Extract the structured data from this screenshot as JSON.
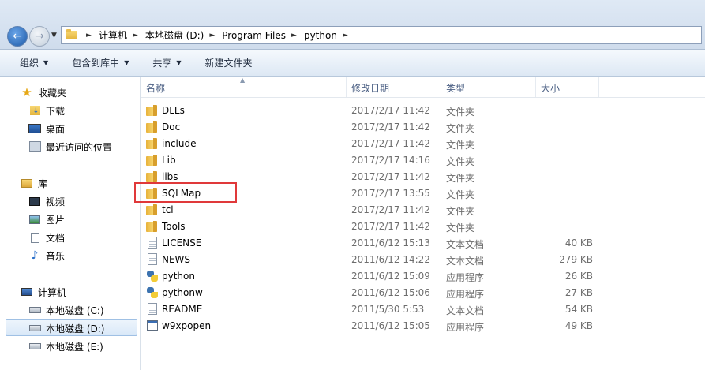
{
  "address": {
    "crumbs": [
      "计算机",
      "本地磁盘 (D:)",
      "Program Files",
      "python"
    ]
  },
  "toolbar": {
    "organize": "组织",
    "include_library": "包含到库中",
    "share": "共享",
    "new_folder": "新建文件夹"
  },
  "nav": {
    "favorites": "收藏夹",
    "downloads": "下载",
    "desktop": "桌面",
    "recent": "最近访问的位置",
    "libraries": "库",
    "videos": "视频",
    "pictures": "图片",
    "documents": "文档",
    "music": "音乐",
    "computer": "计算机",
    "drive_c": "本地磁盘 (C:)",
    "drive_d": "本地磁盘 (D:)",
    "drive_e": "本地磁盘 (E:)"
  },
  "columns": {
    "name": "名称",
    "date": "修改日期",
    "type": "类型",
    "size": "大小"
  },
  "files": [
    {
      "name": "DLLs",
      "date": "2017/2/17 11:42",
      "type": "文件夹",
      "size": "",
      "icon": "folder"
    },
    {
      "name": "Doc",
      "date": "2017/2/17 11:42",
      "type": "文件夹",
      "size": "",
      "icon": "folder"
    },
    {
      "name": "include",
      "date": "2017/2/17 11:42",
      "type": "文件夹",
      "size": "",
      "icon": "folder"
    },
    {
      "name": "Lib",
      "date": "2017/2/17 14:16",
      "type": "文件夹",
      "size": "",
      "icon": "folder"
    },
    {
      "name": "libs",
      "date": "2017/2/17 11:42",
      "type": "文件夹",
      "size": "",
      "icon": "folder"
    },
    {
      "name": "SQLMap",
      "date": "2017/2/17 13:55",
      "type": "文件夹",
      "size": "",
      "icon": "folder"
    },
    {
      "name": "tcl",
      "date": "2017/2/17 11:42",
      "type": "文件夹",
      "size": "",
      "icon": "folder"
    },
    {
      "name": "Tools",
      "date": "2017/2/17 11:42",
      "type": "文件夹",
      "size": "",
      "icon": "folder"
    },
    {
      "name": "LICENSE",
      "date": "2011/6/12 15:13",
      "type": "文本文档",
      "size": "40 KB",
      "icon": "text"
    },
    {
      "name": "NEWS",
      "date": "2011/6/12 14:22",
      "type": "文本文档",
      "size": "279 KB",
      "icon": "text"
    },
    {
      "name": "python",
      "date": "2011/6/12 15:09",
      "type": "应用程序",
      "size": "26 KB",
      "icon": "python"
    },
    {
      "name": "pythonw",
      "date": "2011/6/12 15:06",
      "type": "应用程序",
      "size": "27 KB",
      "icon": "python"
    },
    {
      "name": "README",
      "date": "2011/5/30 5:53",
      "type": "文本文档",
      "size": "54 KB",
      "icon": "text"
    },
    {
      "name": "w9xpopen",
      "date": "2011/6/12 15:05",
      "type": "应用程序",
      "size": "49 KB",
      "icon": "exe"
    }
  ]
}
